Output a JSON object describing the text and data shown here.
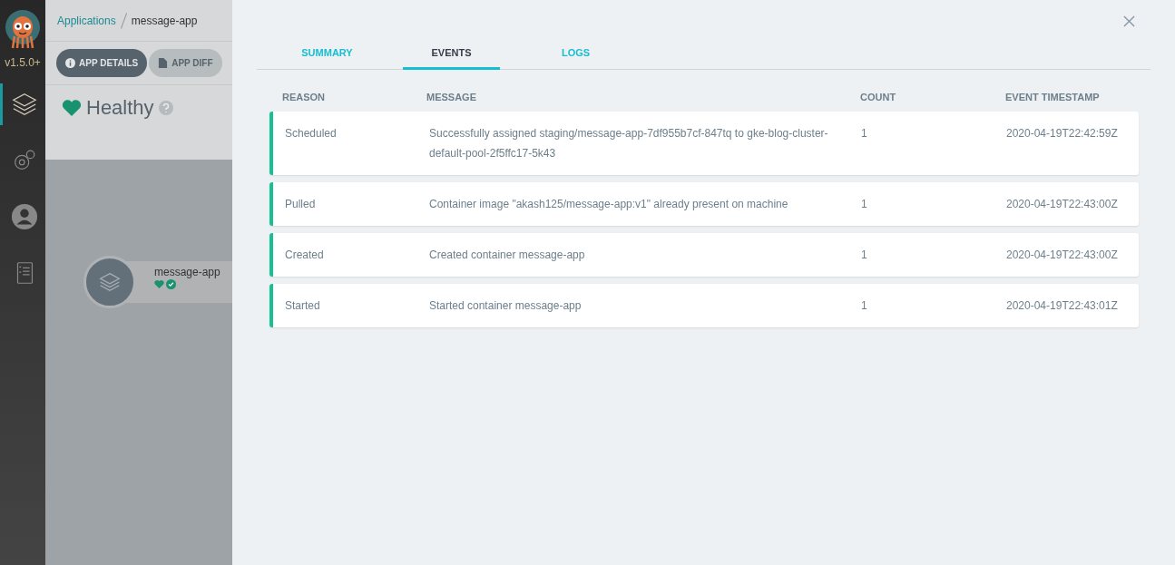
{
  "sidebar": {
    "version": "v1.5.0+",
    "items": [
      {
        "kind": "layers",
        "selected": true
      },
      {
        "kind": "gear",
        "selected": false
      },
      {
        "kind": "user",
        "selected": false
      },
      {
        "kind": "book",
        "selected": false
      }
    ]
  },
  "app": {
    "breadcrumb": {
      "link": "Applications",
      "current": "message-app"
    },
    "buttons": [
      {
        "label": "APP DETAILS",
        "kind": "info",
        "selected": true
      },
      {
        "label": "APP DIFF",
        "kind": "file",
        "selected": false
      }
    ],
    "health": {
      "label": "Healthy"
    },
    "node": {
      "name": "message-app"
    }
  },
  "panel": {
    "tabs": [
      {
        "label": "SUMMARY",
        "selected": false
      },
      {
        "label": "EVENTS",
        "selected": true
      },
      {
        "label": "LOGS",
        "selected": false
      }
    ],
    "columns": [
      "REASON",
      "MESSAGE",
      "COUNT",
      "EVENT TIMESTAMP"
    ],
    "rows": [
      {
        "reason": "Scheduled",
        "message": "Successfully assigned staging/message-app-7df955b7cf-847tq to gke-blog-cluster-default-pool-2f5ffc17-5k43",
        "count": "1",
        "timestamp": "2020-04-19T22:42:59Z"
      },
      {
        "reason": "Pulled",
        "message": "Container image \"akash125/message-app:v1\" already present on machine",
        "count": "1",
        "timestamp": "2020-04-19T22:43:00Z"
      },
      {
        "reason": "Created",
        "message": "Created container message-app",
        "count": "1",
        "timestamp": "2020-04-19T22:43:00Z"
      },
      {
        "reason": "Started",
        "message": "Started container message-app",
        "count": "1",
        "timestamp": "2020-04-19T22:43:01Z"
      }
    ]
  }
}
